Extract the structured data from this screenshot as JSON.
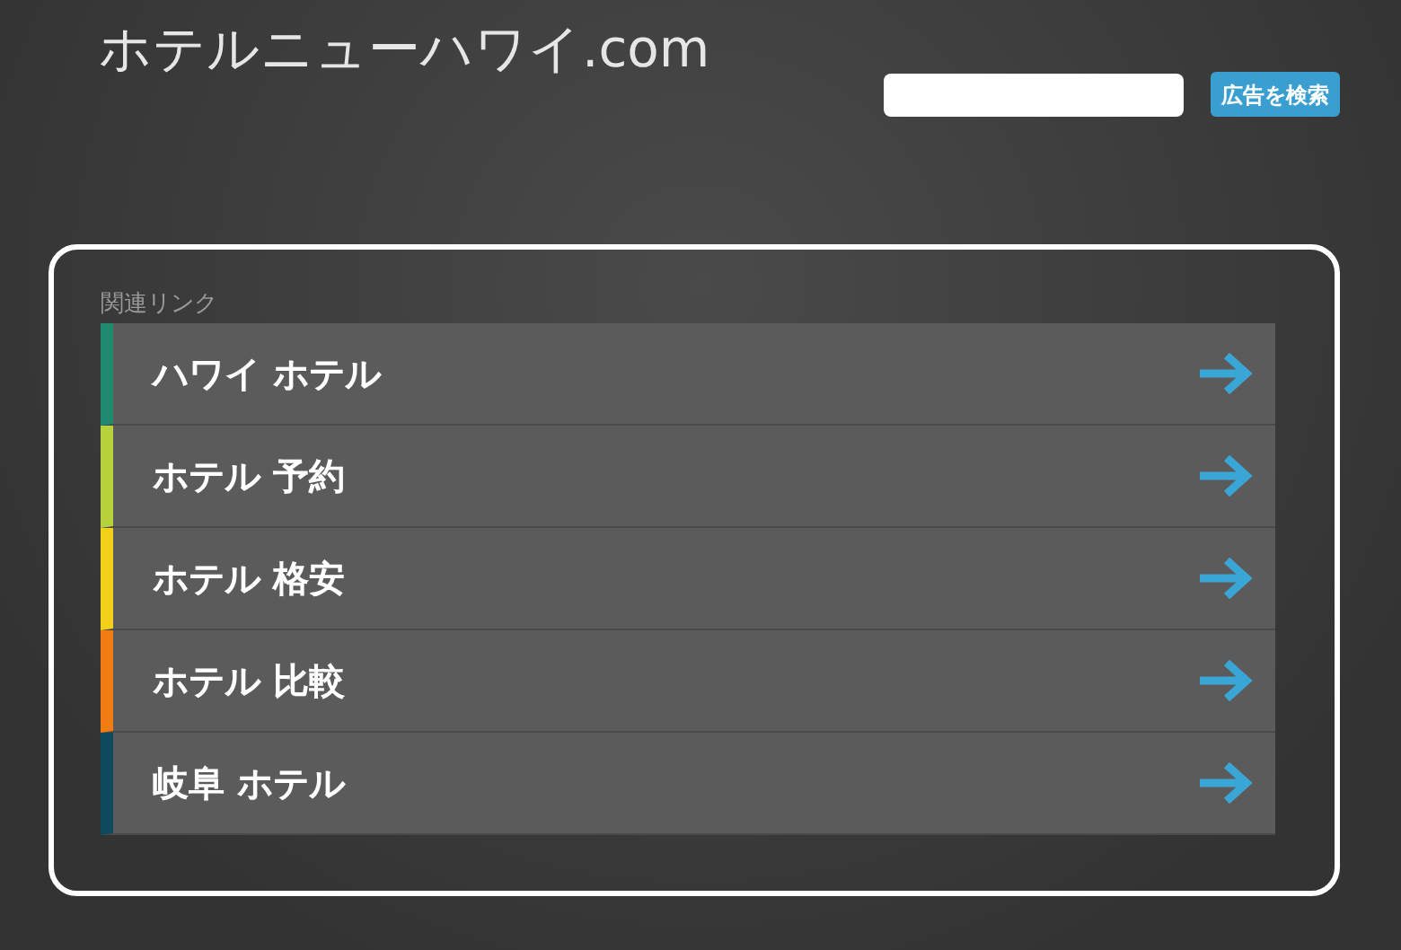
{
  "site_title": "ホテルニューハワイ.com",
  "search": {
    "button": "広告を検索"
  },
  "related": {
    "heading": "関連リンク",
    "links": [
      {
        "label": "ハワイ ホテル",
        "color": "#1f8a6e"
      },
      {
        "label": "ホテル 予約",
        "color": "#b6d23c"
      },
      {
        "label": "ホテル 格安",
        "color": "#f3d11b"
      },
      {
        "label": "ホテル 比較",
        "color": "#f07c13"
      },
      {
        "label": "岐阜 ホテル",
        "color": "#0f4a5c"
      }
    ]
  }
}
